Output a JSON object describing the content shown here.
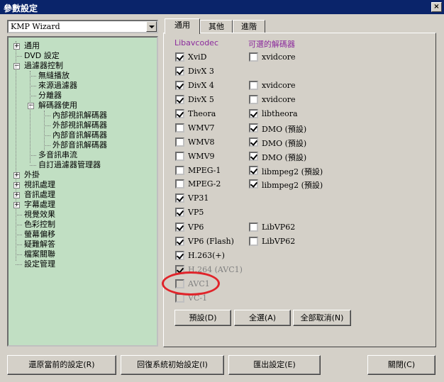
{
  "window": {
    "title": "參數設定",
    "close_label": "×"
  },
  "preset": {
    "value": "KMP Wizard"
  },
  "tree": [
    {
      "label": "通用",
      "expander": "+"
    },
    {
      "label": "DVD 設定",
      "expander": ""
    },
    {
      "label": "過濾器控制",
      "expander": "−"
    },
    {
      "label": "無縫播放",
      "expander": ""
    },
    {
      "label": "來源過濾器",
      "expander": ""
    },
    {
      "label": "分離器",
      "expander": ""
    },
    {
      "label": "解碼器使用",
      "expander": "−"
    },
    {
      "label": "內部視訊解碼器",
      "expander": ""
    },
    {
      "label": "外部視訊解碼器",
      "expander": ""
    },
    {
      "label": "內部音訊解碼器",
      "expander": ""
    },
    {
      "label": "外部音訊解碼器",
      "expander": ""
    },
    {
      "label": "多音訊串流",
      "expander": ""
    },
    {
      "label": "自訂過濾器管理器",
      "expander": ""
    },
    {
      "label": "外掛",
      "expander": "+"
    },
    {
      "label": "視訊處理",
      "expander": "+"
    },
    {
      "label": "音訊處理",
      "expander": "+"
    },
    {
      "label": "字幕處理",
      "expander": "+"
    },
    {
      "label": "視覺效果",
      "expander": ""
    },
    {
      "label": "色彩控制",
      "expander": ""
    },
    {
      "label": "螢幕偏移",
      "expander": ""
    },
    {
      "label": "疑難解答",
      "expander": ""
    },
    {
      "label": "檔案關聯",
      "expander": ""
    },
    {
      "label": "設定管理",
      "expander": ""
    }
  ],
  "tabs": [
    {
      "label": "通用"
    },
    {
      "label": "其他"
    },
    {
      "label": "進階"
    }
  ],
  "columns": {
    "left": "Libavcodec",
    "right": "可選的解碼器"
  },
  "left_items": [
    {
      "label": "XviD",
      "checked": true,
      "disabled": false
    },
    {
      "label": "DivX 3",
      "checked": true,
      "disabled": false
    },
    {
      "label": "DivX 4",
      "checked": true,
      "disabled": false
    },
    {
      "label": "DivX 5",
      "checked": true,
      "disabled": false
    },
    {
      "label": "Theora",
      "checked": true,
      "disabled": false
    },
    {
      "label": "WMV7",
      "checked": false,
      "disabled": false
    },
    {
      "label": "WMV8",
      "checked": false,
      "disabled": false
    },
    {
      "label": "WMV9",
      "checked": false,
      "disabled": false
    },
    {
      "label": "MPEG-1",
      "checked": false,
      "disabled": false
    },
    {
      "label": "MPEG-2",
      "checked": false,
      "disabled": false
    },
    {
      "label": "VP31",
      "checked": true,
      "disabled": false
    },
    {
      "label": "VP5",
      "checked": true,
      "disabled": false
    },
    {
      "label": "VP6",
      "checked": true,
      "disabled": false
    },
    {
      "label": "VP6 (Flash)",
      "checked": true,
      "disabled": false
    },
    {
      "label": "H.263(+)",
      "checked": true,
      "disabled": false
    },
    {
      "label": "H.264 (AVC1)",
      "checked": true,
      "disabled": true
    },
    {
      "label": "AVC1",
      "checked": false,
      "disabled": true
    },
    {
      "label": "VC-1",
      "checked": false,
      "disabled": true
    }
  ],
  "right_items": [
    {
      "label": "xvidcore",
      "checked": false,
      "slot": 0
    },
    {
      "label": "xvidcore",
      "checked": false,
      "slot": 2
    },
    {
      "label": "xvidcore",
      "checked": false,
      "slot": 3
    },
    {
      "label": "libtheora",
      "checked": true,
      "slot": 4
    },
    {
      "label": "DMO (預設)",
      "checked": true,
      "slot": 5
    },
    {
      "label": "DMO (預設)",
      "checked": true,
      "slot": 6
    },
    {
      "label": "DMO (預設)",
      "checked": true,
      "slot": 7
    },
    {
      "label": "libmpeg2 (預設)",
      "checked": true,
      "slot": 8
    },
    {
      "label": "libmpeg2 (預設)",
      "checked": true,
      "slot": 9
    },
    {
      "label": "LibVP62",
      "checked": false,
      "slot": 12
    },
    {
      "label": "LibVP62",
      "checked": false,
      "slot": 13
    }
  ],
  "panel_buttons": {
    "default": "預設(D)",
    "select_all": "全選(A)",
    "select_none": "全部取消(N)"
  },
  "bottom_buttons": {
    "restore": "還原當前的設定(R)",
    "reset": "回復系統初始設定(I)",
    "export": "匯出設定(E)",
    "close": "關閉(C)"
  },
  "colors": {
    "titlebar": "#0a246a",
    "tree_bg": "#c1dfc3",
    "column_heading": "#8b2a9c",
    "highlight": "#e0242a"
  }
}
